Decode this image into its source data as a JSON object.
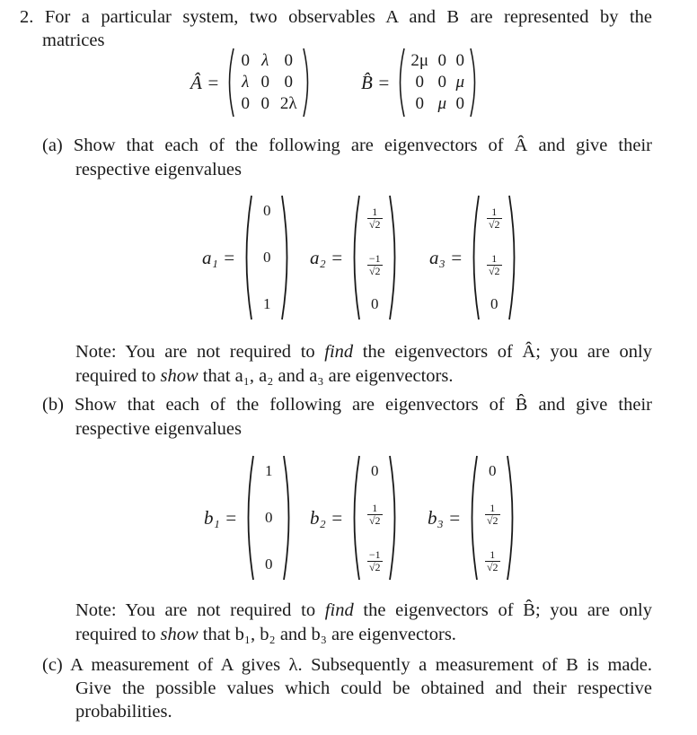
{
  "question": {
    "number": "2.",
    "intro_line1": "For a particular system, two observables A and B are represented by the",
    "intro_line2": "matrices"
  },
  "matrices": {
    "A": {
      "label": "Â =",
      "rows": [
        [
          "0",
          "λ",
          "0"
        ],
        [
          "λ",
          "0",
          "0"
        ],
        [
          "0",
          "0",
          "2λ"
        ]
      ]
    },
    "B": {
      "label": "B̂ =",
      "rows": [
        [
          "2μ",
          "0",
          "0"
        ],
        [
          "0",
          "0",
          "μ"
        ],
        [
          "0",
          "μ",
          "0"
        ]
      ]
    }
  },
  "part_a": {
    "label": "(a)",
    "line1": "Show that each of the following are eigenvectors of Â and give their",
    "line2": "respective eigenvalues",
    "vectors": [
      {
        "name": "a1",
        "label": "a₁ =",
        "entries": [
          {
            "text": "0"
          },
          {
            "text": "0"
          },
          {
            "text": "1"
          }
        ]
      },
      {
        "name": "a2",
        "label": "a₂ =",
        "entries": [
          {
            "num": "1",
            "den": "√2"
          },
          {
            "num": "−1",
            "den": "√2"
          },
          {
            "text": "0"
          }
        ]
      },
      {
        "name": "a3",
        "label": "a₃ =",
        "entries": [
          {
            "num": "1",
            "den": "√2"
          },
          {
            "num": "1",
            "den": "√2"
          },
          {
            "text": "0"
          }
        ]
      }
    ],
    "note_line1_pre": "Note: You are not required to ",
    "note_line1_em": "find",
    "note_line1_post": " the eigenvectors of Â; you are only",
    "note_line2_pre": "required to ",
    "note_line2_em": "show",
    "note_line2_post": " that a₁, a₂ and a₃ are eigenvectors."
  },
  "part_b": {
    "label": "(b)",
    "line1": "Show that each of the following are eigenvectors of B̂ and give their",
    "line2": "respective eigenvalues",
    "vectors": [
      {
        "name": "b1",
        "label": "b₁ =",
        "entries": [
          {
            "text": "1"
          },
          {
            "text": "0"
          },
          {
            "text": "0"
          }
        ]
      },
      {
        "name": "b2",
        "label": "b₂ =",
        "entries": [
          {
            "text": "0"
          },
          {
            "num": "1",
            "den": "√2"
          },
          {
            "num": "−1",
            "den": "√2"
          }
        ]
      },
      {
        "name": "b3",
        "label": "b₃ =",
        "entries": [
          {
            "text": "0"
          },
          {
            "num": "1",
            "den": "√2"
          },
          {
            "num": "1",
            "den": "√2"
          }
        ]
      }
    ],
    "note_line1_pre": "Note: You are not required to ",
    "note_line1_em": "find",
    "note_line1_post": " the eigenvectors of B̂; you are only",
    "note_line2_pre": "required to ",
    "note_line2_em": "show",
    "note_line2_post": " that b₁, b₂ and b₃ are eigenvectors."
  },
  "part_c": {
    "label": "(c)",
    "line1": "A measurement of A gives λ. Subsequently a measurement of B is made.",
    "line2": "Give the possible values which could be obtained and their respective",
    "line3": "probabilities."
  }
}
